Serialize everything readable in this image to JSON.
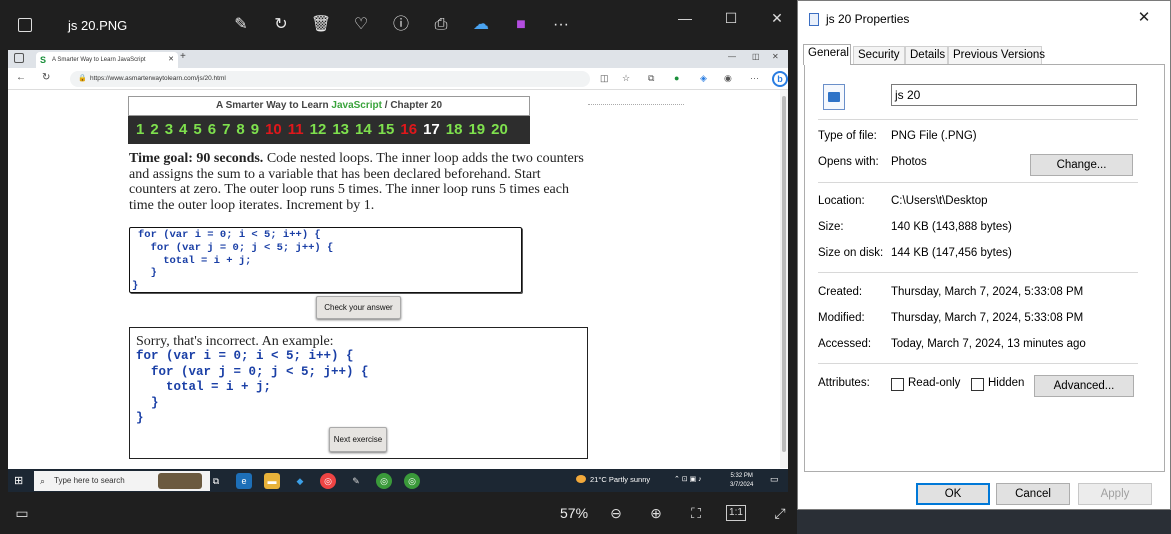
{
  "photos": {
    "title": "js 20.PNG",
    "zoom": "57%",
    "tool_icons": [
      "edit-icon",
      "rotate-icon",
      "delete-icon",
      "favorite-icon",
      "info-icon",
      "print-icon",
      "onedrive-icon",
      "clipchamp-icon",
      "more-icon"
    ]
  },
  "browser": {
    "tab_title": "A Smarter Way to Learn JavaScript",
    "url": "https://www.asmarterwaytolearn.com/js/20.html"
  },
  "page": {
    "chapter_prefix": "A Smarter Way to Learn ",
    "chapter_js": "JavaScript",
    "chapter_suffix": " / Chapter 20",
    "numbers": [
      {
        "n": "1",
        "c": "green"
      },
      {
        "n": "2",
        "c": "green"
      },
      {
        "n": "3",
        "c": "green"
      },
      {
        "n": "4",
        "c": "green"
      },
      {
        "n": "5",
        "c": "green"
      },
      {
        "n": "6",
        "c": "green"
      },
      {
        "n": "7",
        "c": "green"
      },
      {
        "n": "8",
        "c": "green"
      },
      {
        "n": "9",
        "c": "green"
      },
      {
        "n": "10",
        "c": "red"
      },
      {
        "n": "11",
        "c": "red"
      },
      {
        "n": "12",
        "c": "green"
      },
      {
        "n": "13",
        "c": "green"
      },
      {
        "n": "14",
        "c": "green"
      },
      {
        "n": "15",
        "c": "green"
      },
      {
        "n": "16",
        "c": "red"
      },
      {
        "n": "17",
        "c": "white"
      },
      {
        "n": "18",
        "c": "green"
      },
      {
        "n": "19",
        "c": "green"
      },
      {
        "n": "20",
        "c": "green"
      }
    ],
    "goal_label": "Time goal: 90 seconds.",
    "instructions": " Code nested loops. The inner loop adds the two counters and assigns the sum to a variable that has been declared beforehand. Start counters at zero. The outer loop runs 5 times. The inner loop runs 5 times each time the outer loop iterates. Increment by 1.",
    "user_code": "for (var i = 0; i < 5; i++) {\n  for (var j = 0; j < 5; j++) {\n    total = i + j;\n  }",
    "user_code_close": "}",
    "check_button": "Check your answer",
    "result_message": "Sorry, that's incorrect. An example:",
    "example_code": "for (var i = 0; i < 5; i++) {\n  for (var j = 0; j < 5; j++) {\n    total = i + j;\n  }\n}",
    "next_button": "Next exercise"
  },
  "taskbar": {
    "search_placeholder": "Type here to search",
    "weather": "21°C  Partly sunny",
    "time": "5:32 PM",
    "date": "3/7/2024"
  },
  "properties": {
    "title": "js 20 Properties",
    "tabs": [
      "General",
      "Security",
      "Details",
      "Previous Versions"
    ],
    "name": "js 20",
    "type_label": "Type of file:",
    "type_value": "PNG File (.PNG)",
    "opens_label": "Opens with:",
    "opens_value": "Photos",
    "change_button": "Change...",
    "location_label": "Location:",
    "location_value": "C:\\Users\\t\\Desktop",
    "size_label": "Size:",
    "size_value": "140 KB (143,888 bytes)",
    "size_disk_label": "Size on disk:",
    "size_disk_value": "144 KB (147,456 bytes)",
    "created_label": "Created:",
    "created_value": "Thursday, March 7, 2024, 5:33:08 PM",
    "modified_label": "Modified:",
    "modified_value": "Thursday, March 7, 2024, 5:33:08 PM",
    "accessed_label": "Accessed:",
    "accessed_value": "Today, March 7, 2024, 13 minutes ago",
    "attributes_label": "Attributes:",
    "readonly_label": "Read-only",
    "hidden_label": "Hidden",
    "advanced_button": "Advanced...",
    "ok_button": "OK",
    "cancel_button": "Cancel",
    "apply_button": "Apply"
  }
}
